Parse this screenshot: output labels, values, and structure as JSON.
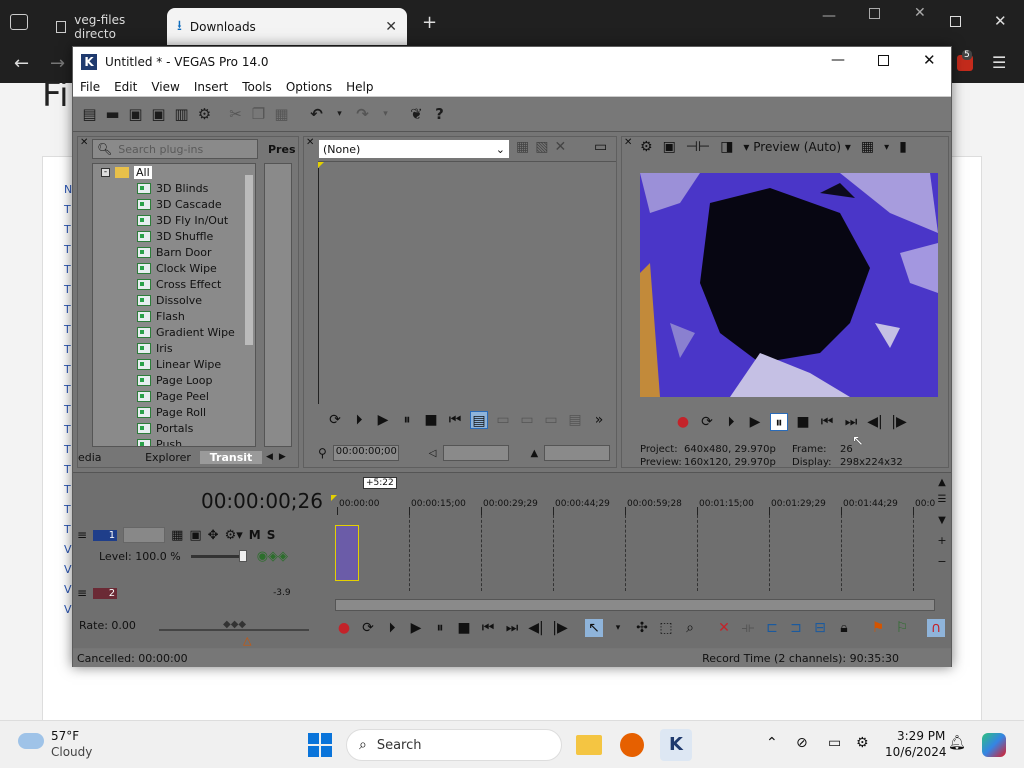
{
  "browser": {
    "tabs": [
      {
        "label": "veg-files directo",
        "active": false
      },
      {
        "label": "Downloads",
        "active": true
      }
    ],
    "new_tab": "+",
    "page_heading_partial": "Fi",
    "badge_count": "5",
    "side_letters": [
      "N",
      "T",
      "T",
      "T",
      "T",
      "T",
      "T",
      "T",
      "T",
      "T",
      "T",
      "T",
      "T",
      "T",
      "T",
      "T",
      "T",
      "T",
      "V",
      "V",
      "V",
      "V"
    ]
  },
  "vegas": {
    "title": "Untitled * - VEGAS Pro 14.0",
    "menu": [
      "File",
      "Edit",
      "View",
      "Insert",
      "Tools",
      "Options",
      "Help"
    ],
    "explorer": {
      "search_placeholder": "Search plug-ins",
      "presets_header": "Pres",
      "root": "All",
      "items": [
        "3D Blinds",
        "3D Cascade",
        "3D Fly In/Out",
        "3D Shuffle",
        "Barn Door",
        "Clock Wipe",
        "Cross Effect",
        "Dissolve",
        "Flash",
        "Gradient Wipe",
        "Iris",
        "Linear Wipe",
        "Page Loop",
        "Page Peel",
        "Page Roll",
        "Portals",
        "Push"
      ],
      "tabs": [
        "edia",
        "Explorer",
        "Transit"
      ]
    },
    "trimmer": {
      "dropdown": "(None)",
      "timecode": "00:00:00;00"
    },
    "preview": {
      "mode": "Preview (Auto)",
      "project_label": "Project:",
      "project_value": "640x480, 29.970p",
      "preview_label": "Preview:",
      "preview_value": "160x120, 29.970p",
      "frame_label": "Frame:",
      "frame_value": "26",
      "display_label": "Display:",
      "display_value": "298x224x32"
    },
    "timeline": {
      "timecode": "00:00:00;26",
      "marker": "+5:22",
      "ruler": [
        "00:00:00",
        "00:00:15;00",
        "00:00:29;29",
        "00:00:44;29",
        "00:00:59;28",
        "00:01:15;00",
        "00:01:29;29",
        "00:01:44;29",
        "00:0"
      ],
      "track_number": "1",
      "track2_number": "2",
      "level": "Level: 100.0 %",
      "rate": "Rate: 0.00",
      "track_m": "M",
      "track_s": "S",
      "db": "-3.9"
    },
    "status": {
      "left": "Cancelled: 00:00:00",
      "right": "Record Time (2 channels): 90:35:30"
    }
  },
  "taskbar": {
    "weather_temp": "57°F",
    "weather_desc": "Cloudy",
    "search_label": "Search",
    "time": "3:29 PM",
    "date": "10/6/2024"
  },
  "colors": {
    "vegas_bg": "#757575",
    "preview_purple": "#4a36c8",
    "accent_blue": "#0067c0"
  }
}
